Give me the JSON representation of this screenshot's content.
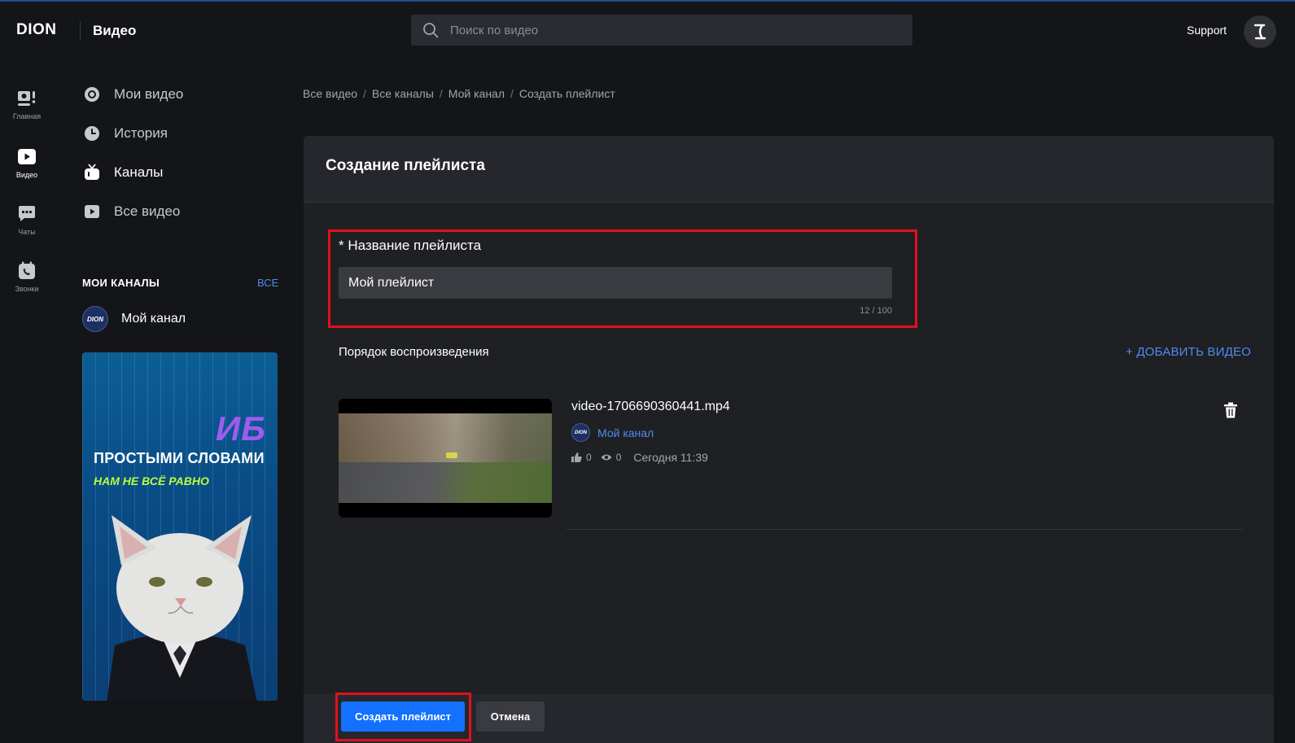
{
  "header": {
    "logo": "DION",
    "section": "Видео",
    "search_placeholder": "Поиск по видео",
    "support": "Support"
  },
  "rail": [
    {
      "label": "Главная",
      "icon": "home-icon"
    },
    {
      "label": "Видео",
      "icon": "video-icon"
    },
    {
      "label": "Чаты",
      "icon": "chat-icon"
    },
    {
      "label": "Звонки",
      "icon": "calls-icon"
    }
  ],
  "nav": [
    {
      "label": "Мои видео",
      "icon": "my-videos-icon"
    },
    {
      "label": "История",
      "icon": "history-icon"
    },
    {
      "label": "Каналы",
      "icon": "channels-icon"
    },
    {
      "label": "Все видео",
      "icon": "all-videos-icon"
    }
  ],
  "my_channels": {
    "title": "МОИ КАНАЛЫ",
    "all_link": "ВСЕ",
    "items": [
      {
        "name": "Мой канал",
        "avatar_text": "DION"
      }
    ]
  },
  "banner": {
    "tag": "ИБ",
    "line1": "ПРОСТЫМИ СЛОВАМИ",
    "line2": "НАМ НЕ ВСЁ РАВНО"
  },
  "breadcrumb": [
    "Все видео",
    "Все каналы",
    "Мой канал",
    "Создать плейлист"
  ],
  "form": {
    "title": "Создание плейлиста",
    "name_label": "* Название плейлиста",
    "name_value": "Мой плейлист",
    "counter": "12 / 100",
    "order_label": "Порядок воспроизведения",
    "add_video": "+ ДОБАВИТЬ ВИДЕО"
  },
  "videos": [
    {
      "title": "video-1706690360441.mp4",
      "channel": "Мой канал",
      "likes": "0",
      "views": "0",
      "date": "Сегодня 11:39"
    }
  ],
  "actions": {
    "create": "Создать плейлист",
    "cancel": "Отмена"
  },
  "colors": {
    "accent": "#1471ff",
    "link": "#4f8bf0",
    "highlight": "#e0111b",
    "background": "#141518",
    "card": "#1f2024"
  }
}
